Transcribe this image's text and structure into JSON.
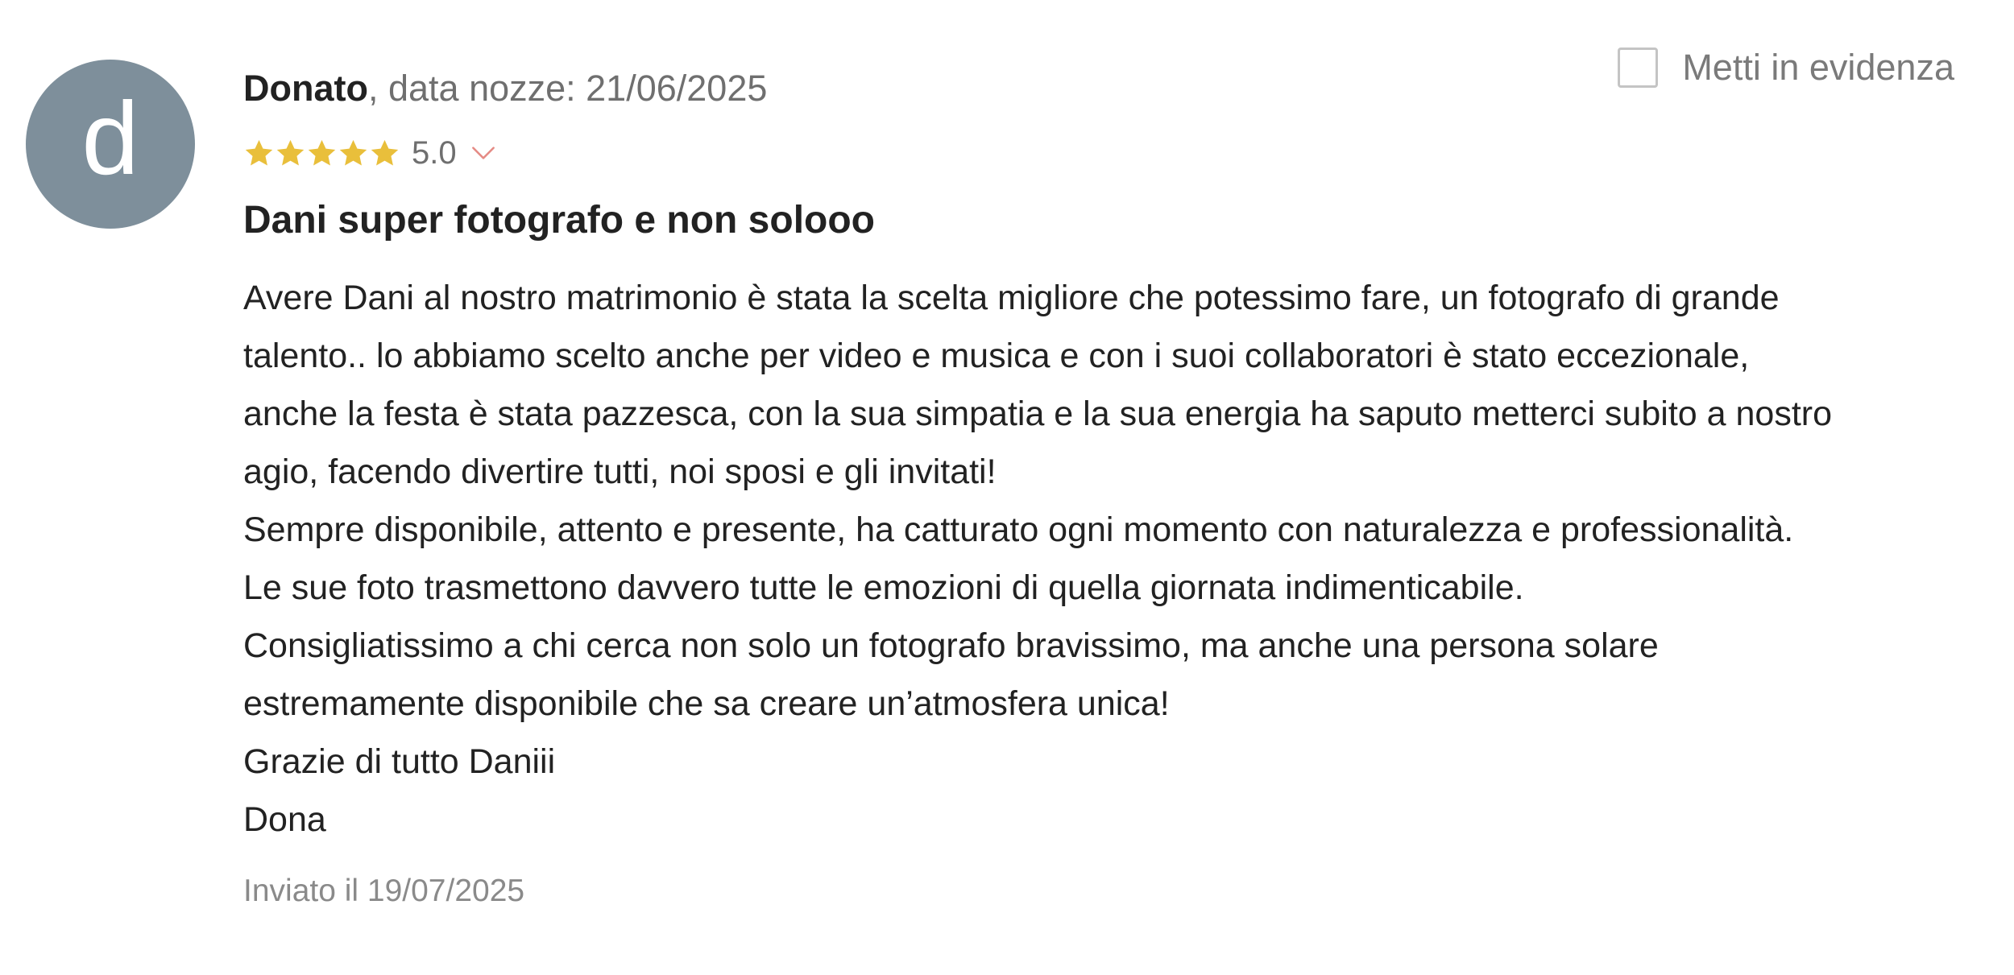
{
  "review": {
    "avatar_letter": "d",
    "author_name": "Donato",
    "wedding_date_text": ", data nozze: 21/06/2025",
    "highlight_label": "Metti in evidenza",
    "rating": {
      "value": "5.0",
      "stars": 5,
      "star_color": "#e9bf3b"
    },
    "title": "Dani super fotografo e non solooo",
    "body_lines": [
      "Avere Dani al nostro matrimonio è stata la scelta migliore che potessimo fare, un fotografo di grande",
      "talento.. lo abbiamo scelto anche per video e musica e con i suoi collaboratori è stato eccezionale,",
      "anche la festa è stata pazzesca, con la sua simpatia e la sua energia ha saputo metterci subito a nostro",
      "agio, facendo divertire tutti, noi sposi e gli invitati!",
      "Sempre disponibile, attento e presente, ha catturato ogni momento con naturalezza e professionalità.",
      "Le sue foto trasmettono davvero tutte le emozioni di quella giornata indimenticabile.",
      "Consigliatissimo a chi cerca non solo un fotografo bravissimo, ma anche una persona solare",
      "estremamente disponibile che sa creare un’atmosfera unica!",
      "Grazie di tutto Daniii",
      "Dona"
    ],
    "sent_date": "Inviato il 19/07/2025"
  },
  "colors": {
    "avatar_bg": "#7e8f9b",
    "chevron": "#e58a84",
    "muted_text": "#6f6f6f"
  },
  "icons": {
    "star": "star-icon",
    "chevron": "chevron-down-icon",
    "checkbox": "checkbox-icon"
  }
}
